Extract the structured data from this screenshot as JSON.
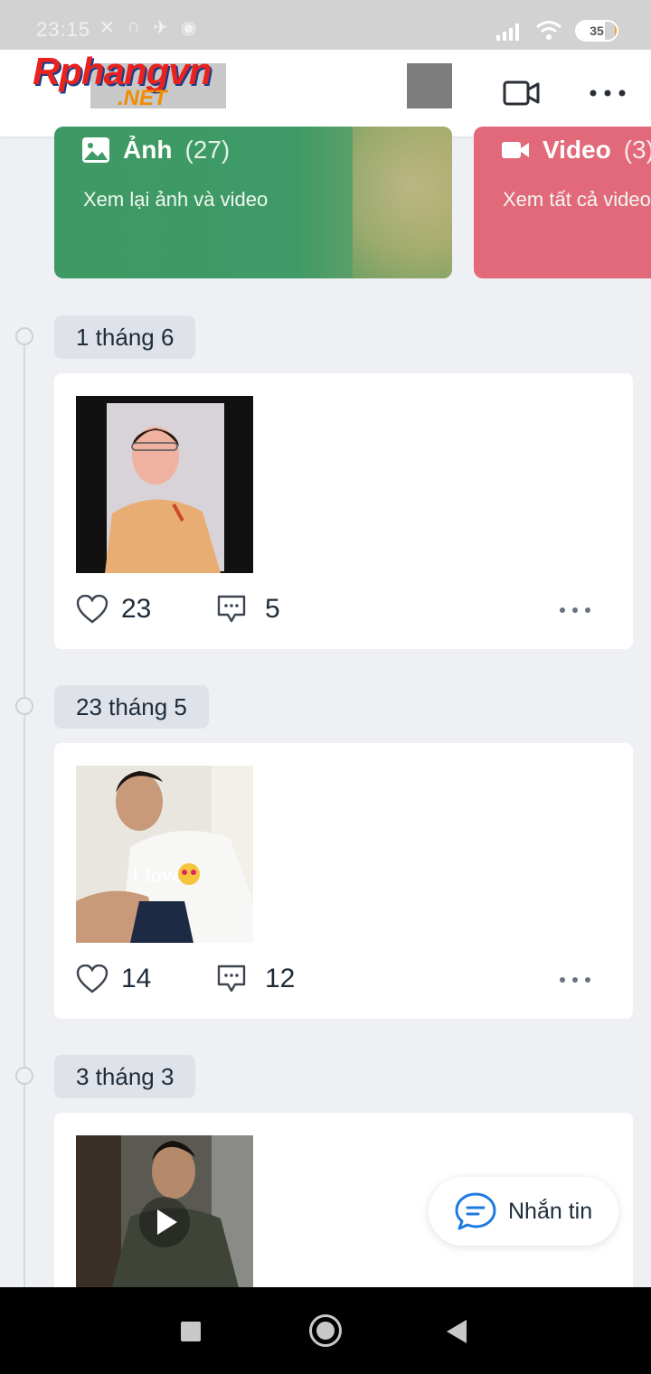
{
  "status_bar": {
    "time": "23:15",
    "battery": "35"
  },
  "header": {
    "watermark_brand": "Rphangvn",
    "watermark_suffix": ".NET"
  },
  "albums": [
    {
      "label": "Ảnh",
      "count": "(27)",
      "subtitle": "Xem lại ảnh và video",
      "color": "#3e9a66"
    },
    {
      "label": "Video",
      "count": "(3)",
      "subtitle": "Xem tất cả video",
      "color": "#e2697a"
    }
  ],
  "posts": [
    {
      "date": "1 tháng 6",
      "likes": "23",
      "comments": "5"
    },
    {
      "date": "23 tháng 5",
      "likes": "14",
      "comments": "12"
    },
    {
      "date": "3 tháng 3"
    }
  ],
  "fab": {
    "label": "Nhắn tin"
  },
  "colors": {
    "accent": "#1f7ae0",
    "text": "#1e2b3a",
    "background": "#eef0f4"
  }
}
